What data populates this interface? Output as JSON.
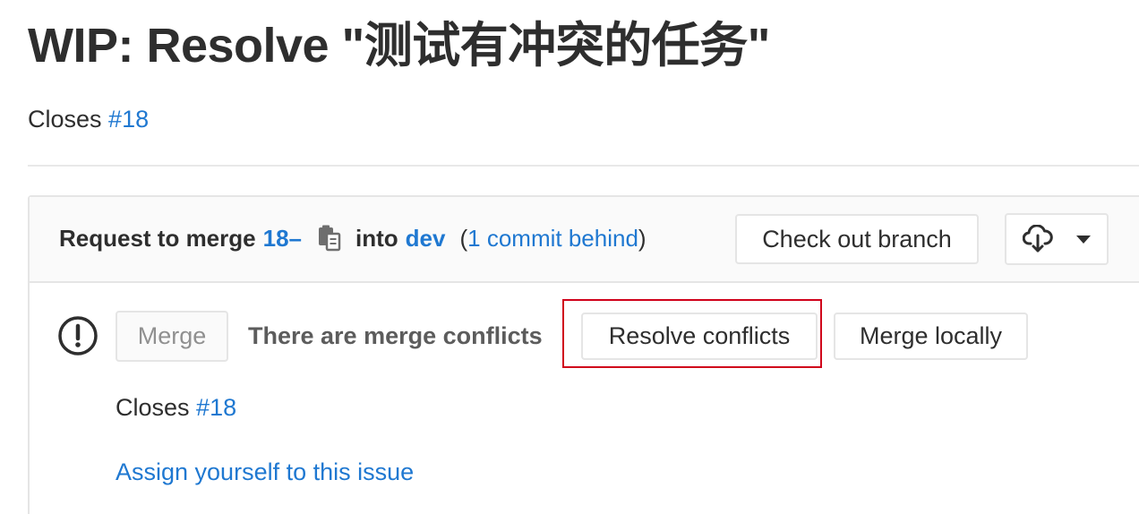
{
  "merge_request": {
    "title": "WIP: Resolve \"测试有冲突的任务\"",
    "description": {
      "prefix": "Closes",
      "issue_ref": "#18"
    }
  },
  "widget": {
    "header": {
      "request_label": "Request to merge",
      "source_branch": "18–",
      "into_label": "into",
      "target_branch": "dev",
      "open_paren": "(",
      "behind_label": "1 commit behind",
      "close_paren": ")",
      "checkout_button": "Check out branch",
      "download_icon": "cloud-download-icon",
      "dropdown_icon": "caret-down-icon",
      "copy_icon": "clipboard-icon"
    },
    "body": {
      "status_icon": "exclamation-circle-icon",
      "merge_button": "Merge",
      "conflict_message": "There are merge conflicts",
      "resolve_button": "Resolve conflicts",
      "merge_locally_button": "Merge locally",
      "closes_prefix": "Closes",
      "closes_issue_ref": "#18",
      "assign_link": "Assign yourself to this issue"
    }
  },
  "colors": {
    "link": "#1f78d1",
    "text": "#2e2e2e",
    "muted_text": "#5c5c5c",
    "border": "#e5e5e5",
    "header_bg": "#fafafa",
    "highlight": "#d0021b"
  }
}
